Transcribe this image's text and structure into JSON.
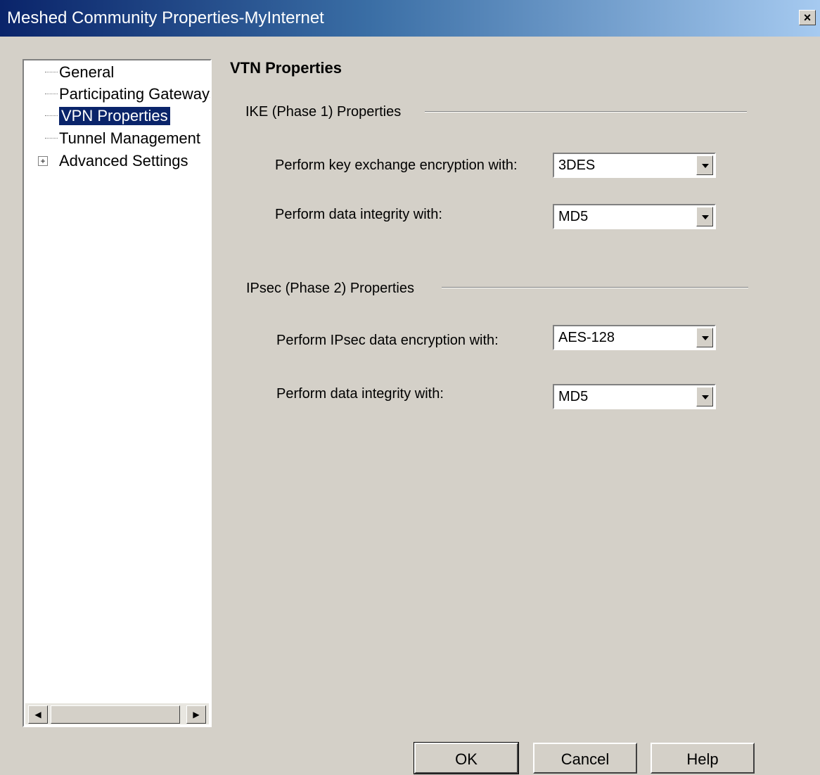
{
  "window": {
    "title": "Meshed Community Properties-MyInternet",
    "close_label": "×"
  },
  "tree": {
    "items": [
      {
        "label": "General"
      },
      {
        "label": "Participating Gateways"
      },
      {
        "label": "VPN Properties"
      },
      {
        "label": "Tunnel Management"
      },
      {
        "label": "Advanced Settings"
      }
    ],
    "selected": "VPN Properties",
    "expander_symbol": "+"
  },
  "scrollbar": {
    "left_arrow": "◀",
    "right_arrow": "▶"
  },
  "main": {
    "heading": "VTN Properties",
    "ike": {
      "title": "IKE (Phase 1) Properties",
      "encryption_label": "Perform key exchange encryption with:",
      "encryption_value": "3DES",
      "integrity_label": "Perform data integrity with:",
      "integrity_value": "MD5"
    },
    "ipsec": {
      "title": "IPsec (Phase 2) Properties",
      "encryption_label": "Perform IPsec data encryption with:",
      "encryption_value": "AES-128",
      "integrity_label": "Perform data integrity with:",
      "integrity_value": "MD5"
    }
  },
  "buttons": {
    "ok": "OK",
    "cancel": "Cancel",
    "help": "Help"
  }
}
